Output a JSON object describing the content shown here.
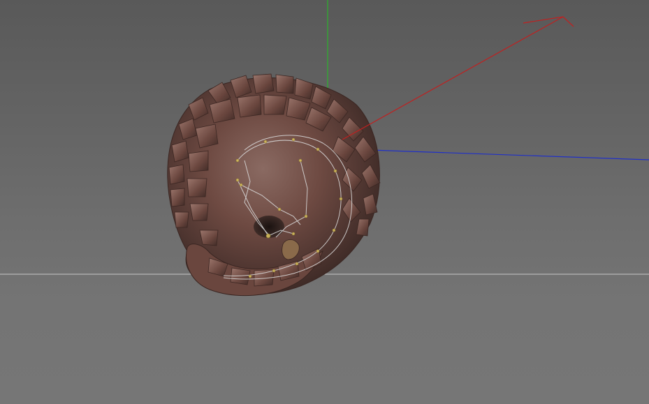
{
  "viewport": {
    "background_color": "#6e6e6e",
    "horizon_color": "#c8c8c8",
    "object": "pangolin-model",
    "rig": "skeleton-overlay"
  },
  "axes": {
    "x_color": "#c02020",
    "y_color": "#2bb52b",
    "z_color": "#2030c8"
  }
}
